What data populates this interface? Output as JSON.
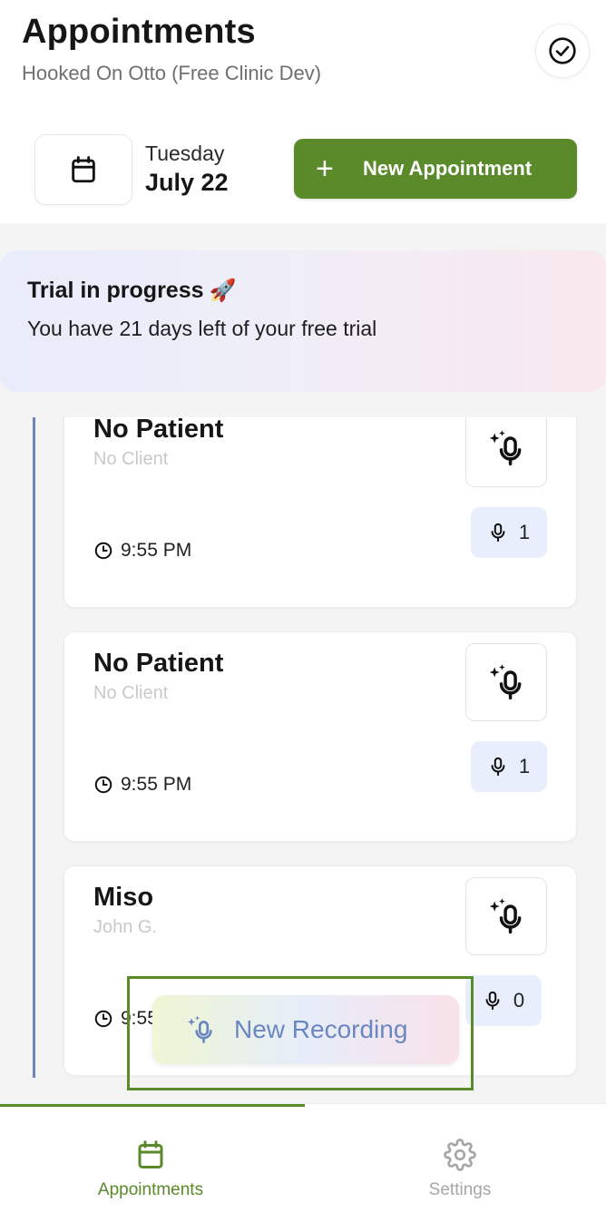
{
  "header": {
    "title": "Appointments",
    "subtitle": "Hooked On Otto (Free Clinic Dev)",
    "date_day": "Tuesday",
    "date_text": "July 22",
    "new_appointment_label": "New Appointment",
    "new_appointment_icon": "plus-icon",
    "calendar_icon": "calendar-icon",
    "status_icon": "check-circle-icon"
  },
  "trial": {
    "title": "Trial in progress",
    "emoji": "🚀",
    "message": "You have 21 days left of your free trial"
  },
  "appointments": [
    {
      "patient": "No Patient",
      "client": "No Client",
      "time": "9:55 PM",
      "recordings": "1"
    },
    {
      "patient": "No Patient",
      "client": "No Client",
      "time": "9:55 PM",
      "recordings": "1"
    },
    {
      "patient": "Miso",
      "client": "John G.",
      "time": "9:55 PM",
      "recordings": "0"
    }
  ],
  "new_recording": {
    "label": "New Recording",
    "icon": "ai-microphone-icon"
  },
  "tabs": [
    {
      "label": "Appointments",
      "icon": "calendar-icon",
      "active": true
    },
    {
      "label": "Settings",
      "icon": "gear-icon",
      "active": false
    }
  ],
  "colors": {
    "accent": "#5a8a2a",
    "timeline": "#6d88b8",
    "recording_text": "#6b86c1",
    "inactive_tab": "#a6a6a6"
  }
}
